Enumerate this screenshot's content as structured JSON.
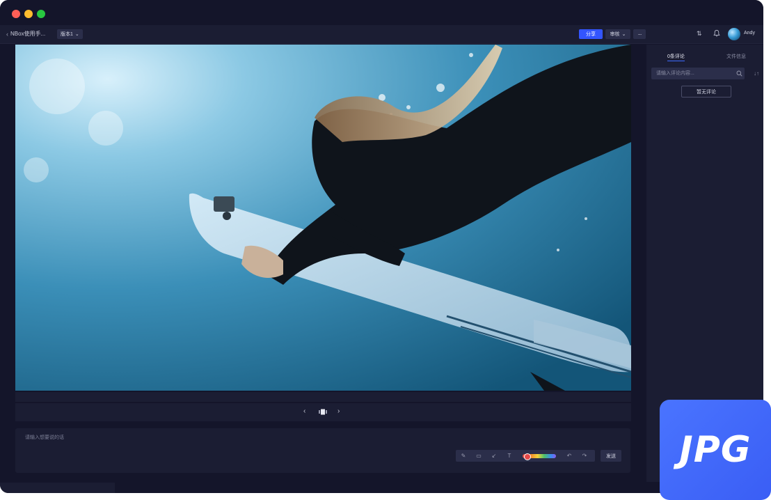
{
  "header": {
    "back_label": "NBox使用手...",
    "version_label": "版本1",
    "share_label": "分享",
    "review_label": "审核",
    "more_label": "···",
    "username": "Andy"
  },
  "viewer": {
    "image_subject": "underwater surfer with surfboard"
  },
  "comment_input": {
    "placeholder": "请输入想要说的话",
    "send_label": "发送"
  },
  "side_panel": {
    "tab_comments": "0条评论",
    "tab_file_info": "文件信息",
    "search_placeholder": "请输入评论内容...",
    "empty_label": "暂无评论"
  },
  "badge": {
    "label": "JPG"
  },
  "colors": {
    "accent": "#3355ff",
    "background": "#14152a",
    "panel": "#1b1d33",
    "badge": "#4a74ff"
  }
}
